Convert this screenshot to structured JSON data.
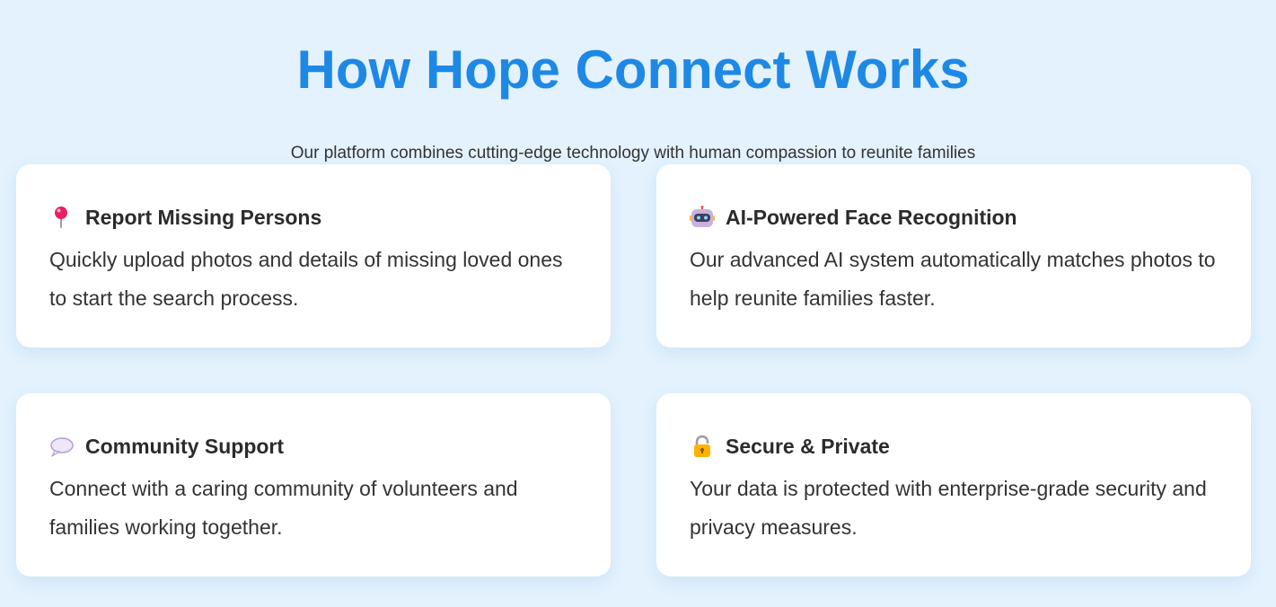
{
  "header": {
    "title": "How Hope Connect Works",
    "subtitle": "Our platform combines cutting-edge technology with human compassion to reunite families"
  },
  "features": [
    {
      "icon": "pushpin-icon",
      "title": "Report Missing Persons",
      "description": "Quickly upload photos and details of missing loved ones to start the search process."
    },
    {
      "icon": "robot-icon",
      "title": "AI-Powered Face Recognition",
      "description": "Our advanced AI system automatically matches photos to help reunite families faster."
    },
    {
      "icon": "speech-bubble-icon",
      "title": "Community Support",
      "description": "Connect with a caring community of volunteers and families working together."
    },
    {
      "icon": "lock-icon",
      "title": "Secure & Private",
      "description": "Your data is protected with enterprise-grade security and privacy measures."
    }
  ],
  "colors": {
    "background": "#e3f2fd",
    "title": "#1e88e5",
    "card": "#ffffff",
    "text": "#333333"
  }
}
